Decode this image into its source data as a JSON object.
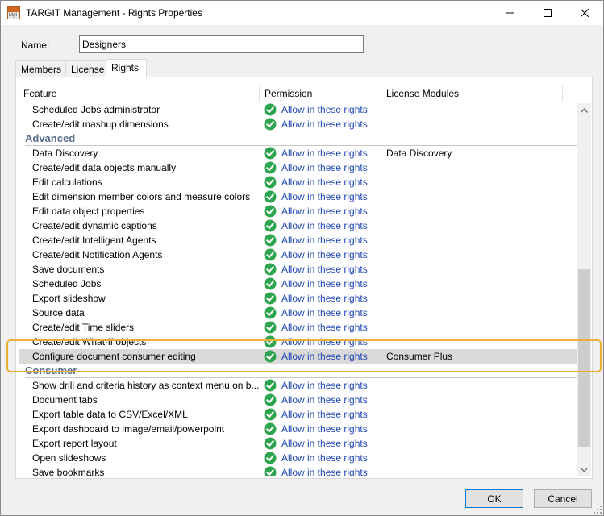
{
  "window": {
    "title": "TARGIT Management - Rights Properties",
    "app_icon_text": "Mgt",
    "accent_color": "#0078d7",
    "highlight_color": "#eab036"
  },
  "form": {
    "name_label": "Name:",
    "name_value": "Designers"
  },
  "tabs": [
    {
      "label": "Members",
      "active": false
    },
    {
      "label": "License",
      "active": false
    },
    {
      "label": "Rights",
      "active": true
    }
  ],
  "grid": {
    "columns": [
      "Feature",
      "Permission",
      "License Modules"
    ],
    "rows": [
      {
        "kind": "item",
        "feature": "Scheduled Jobs administrator",
        "permission": "Allow in these rights",
        "license": ""
      },
      {
        "kind": "item",
        "feature": "Create/edit mashup dimensions",
        "permission": "Allow in these rights",
        "license": ""
      },
      {
        "kind": "group",
        "label": "Advanced"
      },
      {
        "kind": "item",
        "feature": "Data Discovery",
        "permission": "Allow in these rights",
        "license": "Data Discovery"
      },
      {
        "kind": "item",
        "feature": "Create/edit data objects manually",
        "permission": "Allow in these rights",
        "license": ""
      },
      {
        "kind": "item",
        "feature": "Edit calculations",
        "permission": "Allow in these rights",
        "license": ""
      },
      {
        "kind": "item",
        "feature": "Edit dimension member colors and measure colors",
        "permission": "Allow in these rights",
        "license": ""
      },
      {
        "kind": "item",
        "feature": "Edit data object properties",
        "permission": "Allow in these rights",
        "license": ""
      },
      {
        "kind": "item",
        "feature": "Create/edit dynamic captions",
        "permission": "Allow in these rights",
        "license": ""
      },
      {
        "kind": "item",
        "feature": "Create/edit Intelligent Agents",
        "permission": "Allow in these rights",
        "license": ""
      },
      {
        "kind": "item",
        "feature": "Create/edit Notification Agents",
        "permission": "Allow in these rights",
        "license": ""
      },
      {
        "kind": "item",
        "feature": "Save documents",
        "permission": "Allow in these rights",
        "license": ""
      },
      {
        "kind": "item",
        "feature": "Scheduled Jobs",
        "permission": "Allow in these rights",
        "license": ""
      },
      {
        "kind": "item",
        "feature": "Export slideshow",
        "permission": "Allow in these rights",
        "license": ""
      },
      {
        "kind": "item",
        "feature": "Source data",
        "permission": "Allow in these rights",
        "license": ""
      },
      {
        "kind": "item",
        "feature": "Create/edit Time sliders",
        "permission": "Allow in these rights",
        "license": ""
      },
      {
        "kind": "item",
        "feature": "Create/edit What-if objects",
        "permission": "Allow in these rights",
        "license": ""
      },
      {
        "kind": "item",
        "feature": "Configure document consumer editing",
        "permission": "Allow in these rights",
        "license": "Consumer Plus",
        "selected": true
      },
      {
        "kind": "group",
        "label": "Consumer"
      },
      {
        "kind": "item",
        "feature": "Show drill and criteria history as context menu on b...",
        "permission": "Allow in these rights",
        "license": ""
      },
      {
        "kind": "item",
        "feature": "Document tabs",
        "permission": "Allow in these rights",
        "license": ""
      },
      {
        "kind": "item",
        "feature": "Export table data to CSV/Excel/XML",
        "permission": "Allow in these rights",
        "license": ""
      },
      {
        "kind": "item",
        "feature": "Export dashboard to image/email/powerpoint",
        "permission": "Allow in these rights",
        "license": ""
      },
      {
        "kind": "item",
        "feature": "Export report layout",
        "permission": "Allow in these rights",
        "license": ""
      },
      {
        "kind": "item",
        "feature": "Open slideshows",
        "permission": "Allow in these rights",
        "license": ""
      },
      {
        "kind": "item",
        "feature": "Save bookmarks",
        "permission": "Allow in these rights",
        "license": ""
      }
    ]
  },
  "buttons": {
    "ok": "OK",
    "cancel": "Cancel"
  }
}
